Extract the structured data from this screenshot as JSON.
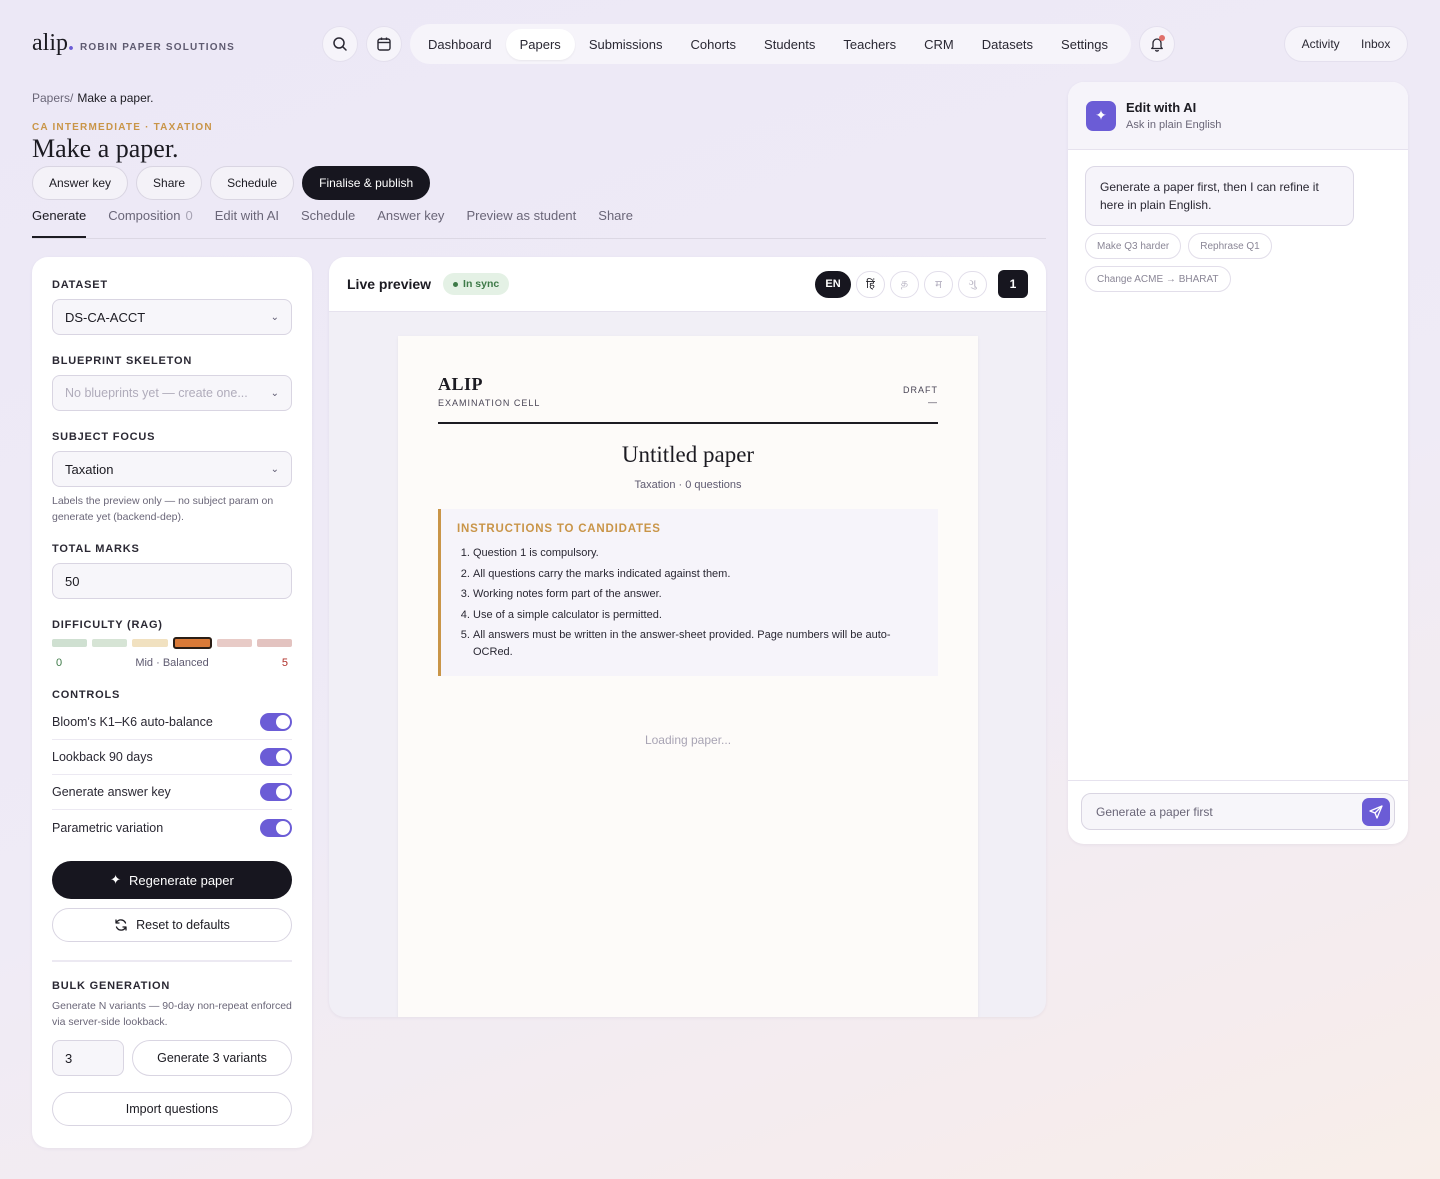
{
  "brand": {
    "mark": "alip",
    "dot": ".",
    "subtitle": "ROBIN PAPER SOLUTIONS"
  },
  "icons": {
    "search": "search-icon",
    "calendar": "calendar-icon",
    "bell": "bell-icon",
    "sparkle": "sparkle-icon",
    "refresh": "refresh-icon",
    "send": "send-icon",
    "chevron": "chevron-down-icon"
  },
  "nav": {
    "items": [
      {
        "label": "Dashboard",
        "active": false
      },
      {
        "label": "Papers",
        "active": true
      },
      {
        "label": "Submissions",
        "active": false
      },
      {
        "label": "Cohorts",
        "active": false
      },
      {
        "label": "Students",
        "active": false
      },
      {
        "label": "Teachers",
        "active": false
      },
      {
        "label": "CRM",
        "active": false
      },
      {
        "label": "Datasets",
        "active": false
      },
      {
        "label": "Settings",
        "active": false
      }
    ],
    "activity": "Activity",
    "inbox": "Inbox"
  },
  "header": {
    "breadcrumb_root": "Papers/",
    "breadcrumb_current": "Make a paper.",
    "eyebrow": "CA INTERMEDIATE · TAXATION",
    "title": "Make a paper.",
    "actions": {
      "answer_key": "Answer key",
      "share": "Share",
      "schedule": "Schedule",
      "publish": "Finalise & publish"
    }
  },
  "tabs": [
    {
      "label": "Generate",
      "count": ""
    },
    {
      "label": "Composition",
      "count": "0"
    },
    {
      "label": "Edit with AI",
      "count": ""
    },
    {
      "label": "Schedule",
      "count": ""
    },
    {
      "label": "Answer key",
      "count": ""
    },
    {
      "label": "Preview as student",
      "count": ""
    },
    {
      "label": "Share",
      "count": ""
    }
  ],
  "form": {
    "dataset": {
      "label": "DATASET",
      "value": "DS-CA-ACCT"
    },
    "blueprint": {
      "label": "BLUEPRINT SKELETON",
      "placeholder": "No blueprints yet — create one..."
    },
    "subject": {
      "label": "SUBJECT FOCUS",
      "value": "Taxation",
      "hint": "Labels the preview only — no subject param on generate yet (backend-dep)."
    },
    "marks": {
      "label": "TOTAL MARKS",
      "value": "50"
    },
    "difficulty": {
      "label": "DIFFICULTY (RAG)",
      "segment_colors": [
        "#cfe0d1",
        "#d6e4d5",
        "#f1e1c0",
        "#d97a38",
        "#e8cbc7",
        "#e3c3c0"
      ],
      "selected_index": 3,
      "min": "0",
      "mid": "Mid · Balanced",
      "max": "5",
      "min_color": "#3e7a48",
      "max_color": "#b0302a"
    },
    "controls": {
      "label": "CONTROLS",
      "items": [
        {
          "label": "Bloom's K1–K6 auto-balance",
          "on": true
        },
        {
          "label": "Lookback 90 days",
          "on": true
        },
        {
          "label": "Generate answer key",
          "on": true
        },
        {
          "label": "Parametric variation",
          "on": true
        }
      ]
    },
    "regenerate": "Regenerate paper",
    "reset": "Reset to defaults",
    "bulk": {
      "label": "BULK GENERATION",
      "hint": "Generate N variants — 90-day non-repeat enforced via server-side lookback.",
      "count": "3",
      "button": "Generate 3 variants",
      "import": "Import questions"
    }
  },
  "preview": {
    "title": "Live preview",
    "status": "In sync",
    "languages": [
      "EN",
      "हिं",
      "த",
      "म",
      "ગુ"
    ],
    "page": "1",
    "sheet": {
      "brand": "ALIP",
      "cell": "EXAMINATION CELL",
      "draft": "DRAFT",
      "draft_sub": "—",
      "title": "Untitled paper",
      "meta": "Taxation · 0 questions",
      "instructions_title": "INSTRUCTIONS TO CANDIDATES",
      "instructions": [
        "Question 1 is compulsory.",
        "All questions carry the marks indicated against them.",
        "Working notes form part of the answer.",
        "Use of a simple calculator is permitted.",
        "All answers must be written in the answer-sheet provided. Page numbers will be auto-OCRed."
      ],
      "loading": "Loading paper..."
    }
  },
  "ai": {
    "title": "Edit with AI",
    "subtitle": "Ask in plain English",
    "message": "Generate a paper first, then I can refine it here in plain English.",
    "chips": [
      "Make Q3 harder",
      "Rephrase Q1",
      "Change ACME → BHARAT"
    ],
    "input_placeholder": "Generate a paper first"
  },
  "colors": {
    "accent": "#6b5cd6",
    "gold": "#c99548",
    "dark": "#17161f"
  }
}
